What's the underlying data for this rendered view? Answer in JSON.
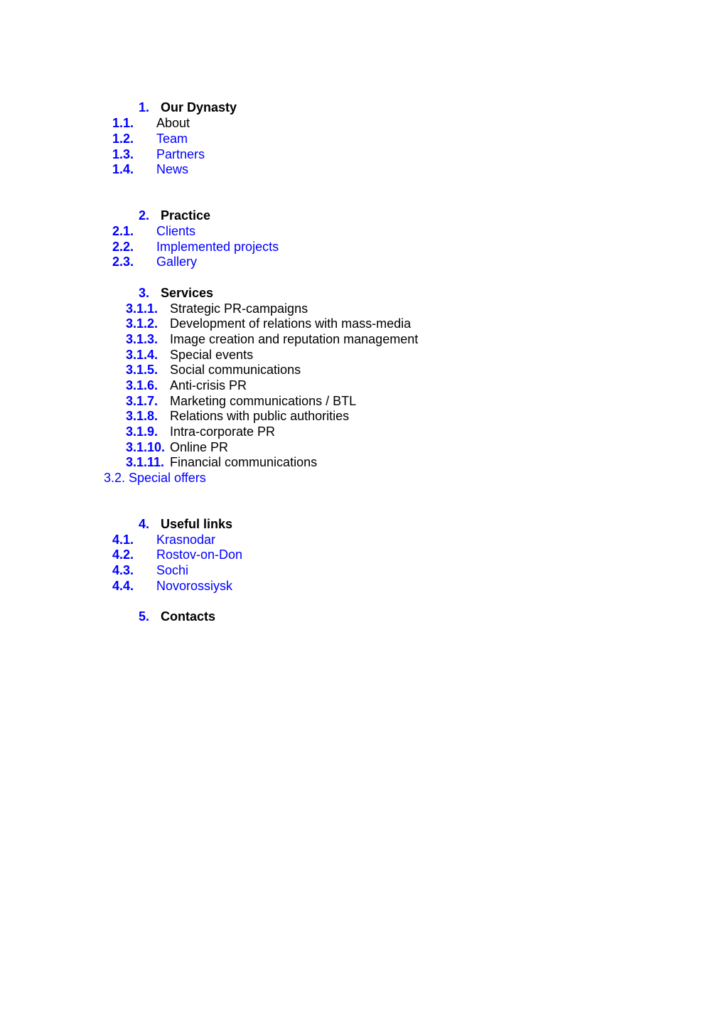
{
  "sections": [
    {
      "number": "1.",
      "title": "Our Dynasty",
      "items": [
        {
          "number": "1.1.",
          "label": "About",
          "is_link": false
        },
        {
          "number": "1.2.",
          "label": "Team",
          "is_link": true
        },
        {
          "number": "1.3.",
          "label": "Partners",
          "is_link": true
        },
        {
          "number": "1.4.",
          "label": "News",
          "is_link": true
        }
      ]
    },
    {
      "number": "2.",
      "title": "Practice",
      "items": [
        {
          "number": "2.1.",
          "label": "Clients",
          "is_link": true
        },
        {
          "number": "2.2.",
          "label": "Implemented projects",
          "is_link": true
        },
        {
          "number": "2.3.",
          "label": "Gallery",
          "is_link": true
        }
      ]
    },
    {
      "number": "3.",
      "title": "Services",
      "items": [
        {
          "number": "3.1.1.",
          "label": "Strategic PR-campaigns"
        },
        {
          "number": "3.1.2.",
          "label": "Development of relations with mass-media"
        },
        {
          "number": "3.1.3.",
          "label": "Image creation and reputation management"
        },
        {
          "number": "3.1.4.",
          "label": "Special events"
        },
        {
          "number": "3.1.5.",
          "label": "Social communications"
        },
        {
          "number": "3.1.6.",
          "label": "Anti-crisis PR"
        },
        {
          "number": "3.1.7.",
          "label": "Marketing communications / BTL"
        },
        {
          "number": "3.1.8.",
          "label": "Relations with public authorities"
        },
        {
          "number": "3.1.9.",
          "label": "Intra-corporate PR"
        },
        {
          "number": "3.1.10.",
          "label": "Online PR"
        },
        {
          "number": "3.1.11.",
          "label": "Financial communications"
        }
      ],
      "special_offers": "3.2. Special offers"
    },
    {
      "number": "4.",
      "title": "Useful links",
      "items": [
        {
          "number": "4.1.",
          "label": "Krasnodar",
          "is_link": true
        },
        {
          "number": "4.2.",
          "label": "Rostov-on-Don",
          "is_link": true
        },
        {
          "number": "4.3.",
          "label": "Sochi",
          "is_link": true
        },
        {
          "number": "4.4.",
          "label": "Novorossiysk",
          "is_link": true
        }
      ]
    },
    {
      "number": "5.",
      "title": "Contacts",
      "items": []
    }
  ],
  "colors": {
    "accent": "#0000ff",
    "text": "#000000"
  }
}
